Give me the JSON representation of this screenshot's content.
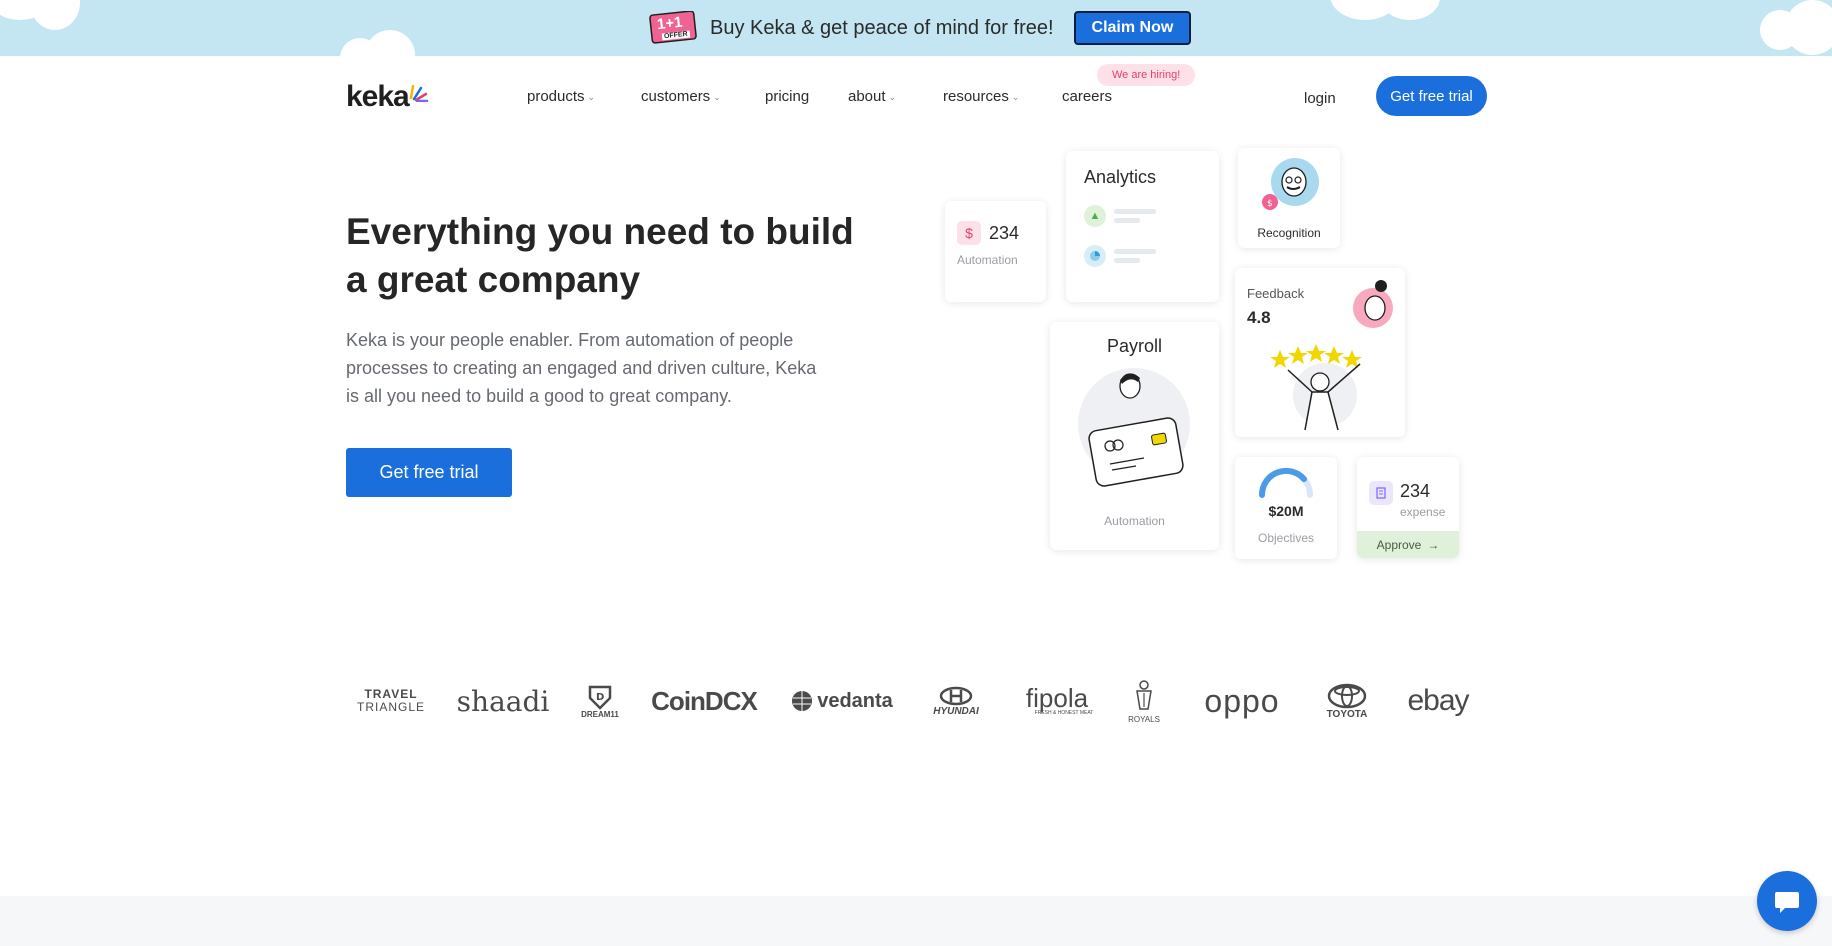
{
  "promo": {
    "badge_main": "1+1",
    "badge_sub": "OFFER",
    "text": "Buy Keka & get peace of mind for free!",
    "cta": "Claim Now"
  },
  "nav": {
    "logo": "keka",
    "items": [
      {
        "label": "products",
        "dropdown": true
      },
      {
        "label": "customers",
        "dropdown": true
      },
      {
        "label": "pricing",
        "dropdown": false
      },
      {
        "label": "about",
        "dropdown": true
      },
      {
        "label": "resources",
        "dropdown": true
      },
      {
        "label": "careers",
        "dropdown": false
      }
    ],
    "hiring_badge": "We are hiring!",
    "login": "login",
    "cta": "Get free trial"
  },
  "hero": {
    "title": "Everything you need to build a great company",
    "description": "Keka is your people enabler. From automation of people processes to creating an engaged and driven culture, Keka is all you need to build a good to great company.",
    "cta": "Get free trial"
  },
  "cards": {
    "automation": {
      "value": "234",
      "label": "Automation"
    },
    "analytics": {
      "title": "Analytics"
    },
    "recognition": {
      "label": "Recognition"
    },
    "feedback": {
      "title": "Feedback",
      "value": "4.8"
    },
    "payroll": {
      "title": "Payroll",
      "label": "Automation"
    },
    "objectives": {
      "value": "$20M",
      "label": "Objectives"
    },
    "expense": {
      "value": "234",
      "label": "expense",
      "action": "Approve"
    }
  },
  "logos": {
    "items": [
      {
        "line1": "TRAVEL",
        "line2": "TRIANGLE"
      },
      {
        "line1": "shaadi",
        "line2": ""
      },
      {
        "line1": "DREAM11",
        "line2": ""
      },
      {
        "line1": "CoinDCX",
        "line2": ""
      },
      {
        "line1": "vedanta",
        "line2": ""
      },
      {
        "line1": "HYUNDAI",
        "line2": ""
      },
      {
        "line1": "fipola",
        "line2": "FRESH & HONEST MEAT"
      },
      {
        "line1": "ROYALS",
        "line2": ""
      },
      {
        "line1": "oppo",
        "line2": ""
      },
      {
        "line1": "TOYOTA",
        "line2": ""
      },
      {
        "line1": "ebay",
        "line2": ""
      }
    ]
  },
  "colors": {
    "primary": "#1a6fdc",
    "banner": "#c3e6f2",
    "hiring_bg": "#fde0e8",
    "approve_bg": "#dff1d8"
  },
  "icons": {
    "chat": "chat-bubble-icon",
    "chevron": "chevron-down-icon"
  }
}
